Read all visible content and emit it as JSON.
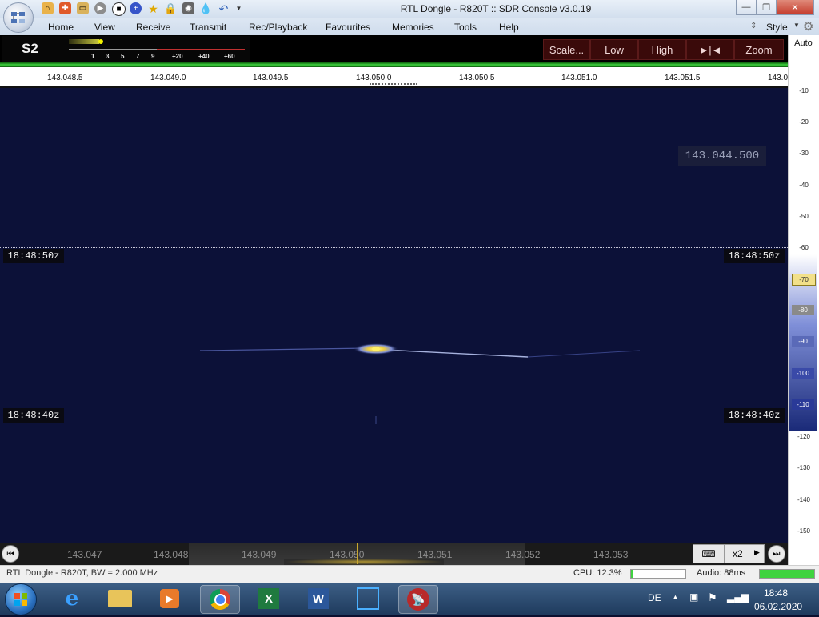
{
  "window": {
    "title": "RTL Dongle - R820T :: SDR Console v3.0.19",
    "style_label": "Style"
  },
  "menu": [
    "Home",
    "View",
    "Receive",
    "Transmit",
    "Rec/Playback",
    "Favourites",
    "Memories",
    "Tools",
    "Help"
  ],
  "smeter": {
    "reading": "S2",
    "scale": [
      "1",
      "3",
      "5",
      "7",
      "9",
      "+20",
      "+40",
      "+60"
    ]
  },
  "toolbar_buttons": [
    "Scale...",
    "Low",
    "High",
    "►|◄",
    "Zoom"
  ],
  "freq_scale_labels": [
    "143.048.5",
    "143.049.0",
    "143.049.5",
    "143.050.0",
    "143.050.5",
    "143.051.0",
    "143.051.5",
    "143.0"
  ],
  "waterfall": {
    "frequency_readout": "143.044.500",
    "timestamps": [
      "18:48:50z",
      "18:48:40z"
    ]
  },
  "db_scale": {
    "auto_label": "Auto",
    "labels": [
      "-10",
      "-20",
      "-30",
      "-40",
      "-50",
      "-60",
      "-70",
      "-80",
      "-90",
      "-100",
      "-110",
      "-120",
      "-130",
      "-140",
      "-150"
    ]
  },
  "band_labels": [
    "143.047",
    "143.048",
    "143.049",
    "143.050",
    "143.051",
    "143.052",
    "143.053"
  ],
  "zoom_select": "x2",
  "status": {
    "device": "RTL Dongle - R820T, BW = 2.000 MHz",
    "cpu": "CPU: 12.3%",
    "cpu_fraction": 0.05,
    "audio": "Audio: 88ms",
    "audio_fraction": 1.0
  },
  "taskbar": {
    "language": "DE",
    "time": "18:48",
    "date": "06.02.2020"
  },
  "colors": {
    "waterfall_bg": "#0c1138",
    "signal": "#fff066",
    "toolbar_btn": "#3a0a0a",
    "level_green": "#3fd33f"
  }
}
